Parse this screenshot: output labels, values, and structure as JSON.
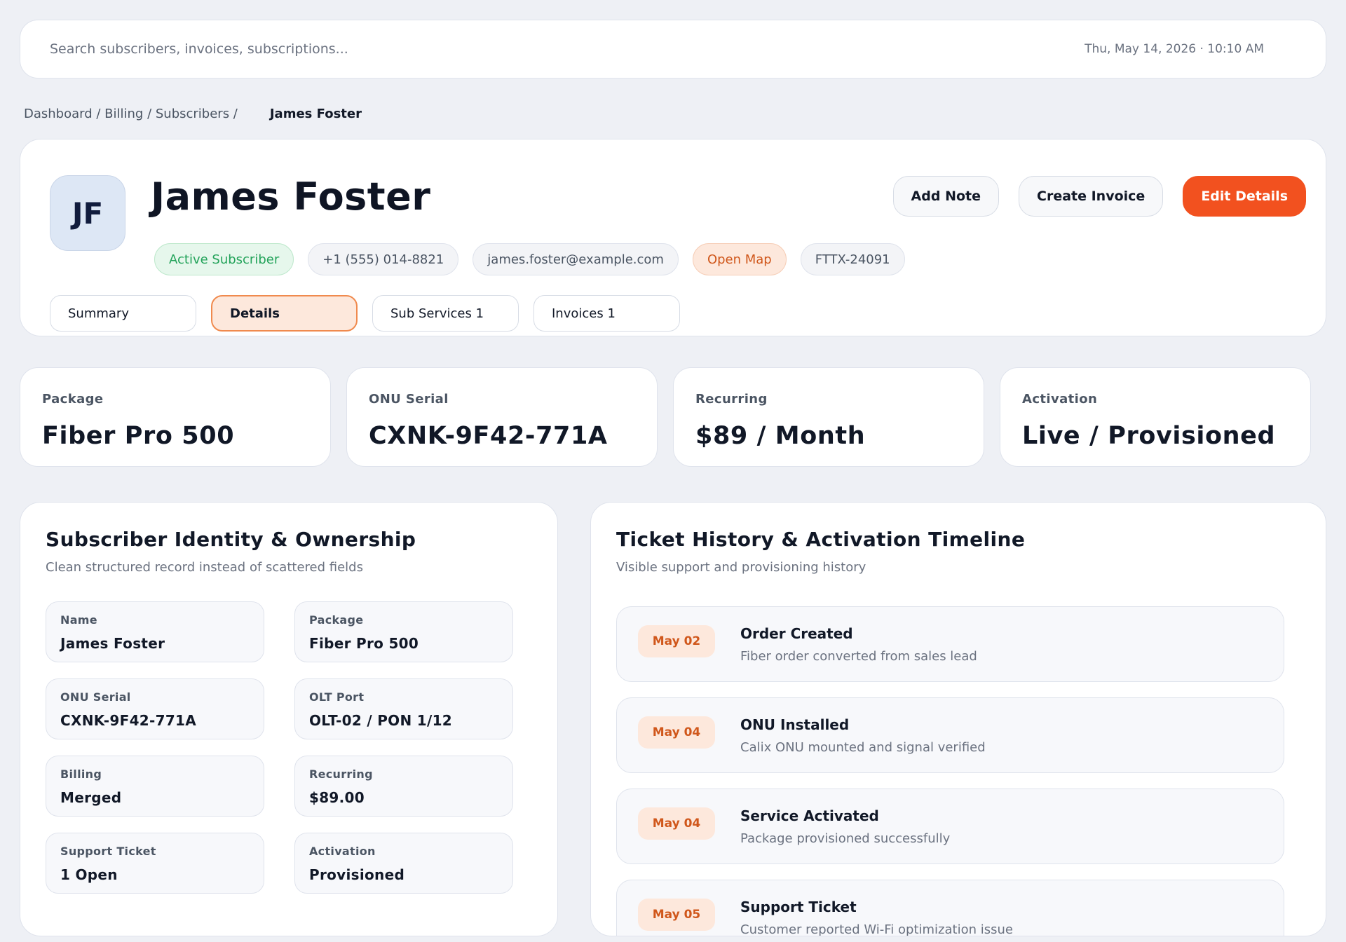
{
  "topbar": {
    "search_placeholder": "Search subscribers, invoices, subscriptions...",
    "datetime": "Thu, May 14, 2026 · 10:10 AM"
  },
  "breadcrumb": {
    "path": "Dashboard / Billing / Subscribers /",
    "current": "James Foster"
  },
  "profile": {
    "initials": "JF",
    "name": "James Foster",
    "chips": {
      "status": "Active Subscriber",
      "phone": "+1 (555) 014-8821",
      "email": "james.foster@example.com",
      "map": "Open Map",
      "account": "FTTX-24091"
    },
    "actions": {
      "add_note": "Add Note",
      "create_invoice": "Create Invoice",
      "edit_details": "Edit Details"
    },
    "tabs": [
      "Summary",
      "Details",
      "Sub Services 1",
      "Invoices 1"
    ],
    "selected_tab": "Details"
  },
  "stats": [
    {
      "label": "Package",
      "value": "Fiber Pro 500"
    },
    {
      "label": "ONU Serial",
      "value": "CXNK-9F42-771A"
    },
    {
      "label": "Recurring",
      "value": "$89 / Month"
    },
    {
      "label": "Activation",
      "value": "Live / Provisioned"
    }
  ],
  "identity": {
    "title": "Subscriber Identity & Ownership",
    "subtitle": "Clean structured record instead of scattered fields",
    "fields": [
      {
        "label": "Name",
        "value": "James Foster"
      },
      {
        "label": "Package",
        "value": "Fiber Pro 500"
      },
      {
        "label": "ONU Serial",
        "value": "CXNK-9F42-771A"
      },
      {
        "label": "OLT Port",
        "value": "OLT-02 / PON 1/12"
      },
      {
        "label": "Billing",
        "value": "Merged"
      },
      {
        "label": "Recurring",
        "value": "$89.00"
      },
      {
        "label": "Support Ticket",
        "value": "1 Open"
      },
      {
        "label": "Activation",
        "value": "Provisioned"
      }
    ]
  },
  "timeline": {
    "title": "Ticket History & Activation Timeline",
    "subtitle": "Visible support and provisioning history",
    "events": [
      {
        "date": "May 02",
        "title": "Order Created",
        "desc": "Fiber order converted from sales lead"
      },
      {
        "date": "May 04",
        "title": "ONU Installed",
        "desc": "Calix ONU mounted and signal verified"
      },
      {
        "date": "May 04",
        "title": "Service Activated",
        "desc": "Package provisioned successfully"
      },
      {
        "date": "May 05",
        "title": "Support Ticket",
        "desc": "Customer reported Wi-Fi optimization issue"
      }
    ]
  },
  "colors": {
    "accent": "#f2511f",
    "active_green": "#23a35a",
    "date_badge_bg": "#fde8dc"
  }
}
